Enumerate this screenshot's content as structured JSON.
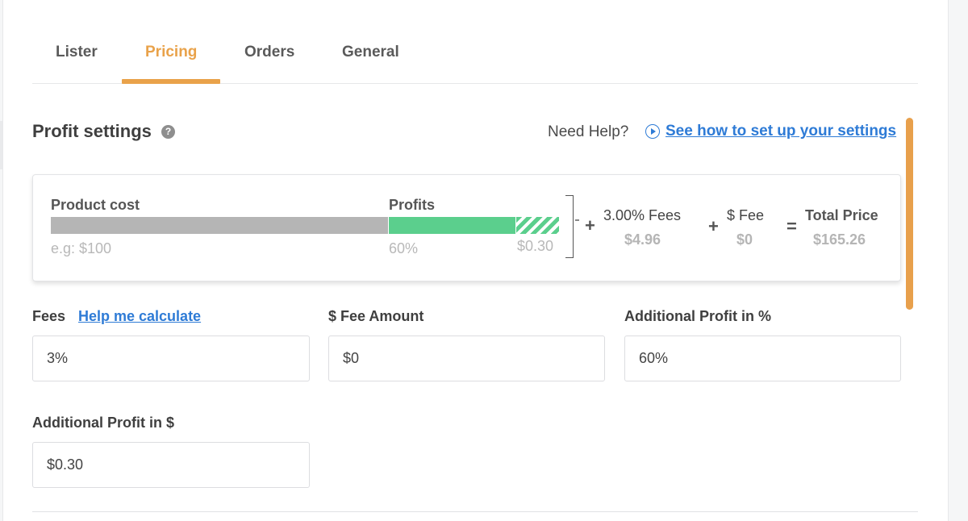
{
  "tabs": [
    {
      "label": "Lister",
      "active": false
    },
    {
      "label": "Pricing",
      "active": true
    },
    {
      "label": "Orders",
      "active": false
    },
    {
      "label": "General",
      "active": false
    }
  ],
  "colors": {
    "accent": "#e9a24a",
    "link": "#2e7bd6",
    "profit_green": "#5bcf8d",
    "cost_gray": "#b5b5b5"
  },
  "section": {
    "title": "Profit settings",
    "help_icon_glyph": "?",
    "need_help": "Need Help?",
    "guide_link": "See how to set up your settings"
  },
  "summary": {
    "product_cost_label": "Product cost",
    "product_cost_example": "e.g: $100",
    "profits_label": "Profits",
    "profit_percent": "60%",
    "profit_fixed": "$0.30",
    "plus": "+",
    "equals": "=",
    "fees_label": "3.00% Fees",
    "fees_value": "$4.96",
    "fee_label": "$ Fee",
    "fee_value": "$0",
    "total_label": "Total Price",
    "total_value": "$165.26"
  },
  "form": {
    "fees": {
      "label": "Fees",
      "help_link": "Help me calculate",
      "value": "3%"
    },
    "fee_amount": {
      "label": "$ Fee Amount",
      "value": "$0"
    },
    "profit_pct": {
      "label": "Additional Profit in %",
      "value": "60%"
    },
    "profit_usd": {
      "label": "Additional Profit in $",
      "value": "$0.30"
    }
  }
}
